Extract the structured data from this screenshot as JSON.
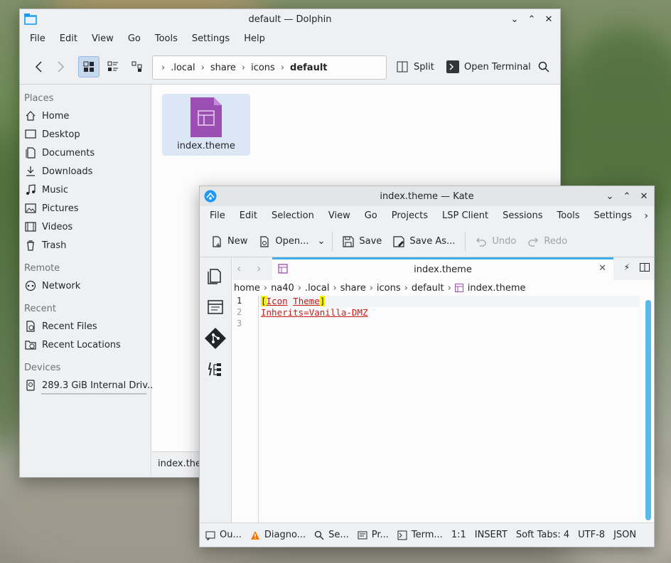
{
  "dolphin": {
    "title": "default — Dolphin",
    "menu": [
      "File",
      "Edit",
      "View",
      "Go",
      "Tools",
      "Settings",
      "Help"
    ],
    "breadcrumb": [
      ".local",
      "share",
      "icons",
      "default"
    ],
    "split_label": "Split",
    "terminal_label": "Open Terminal",
    "sections": {
      "places": "Places",
      "remote": "Remote",
      "recent": "Recent",
      "devices": "Devices"
    },
    "places": [
      "Home",
      "Desktop",
      "Documents",
      "Downloads",
      "Music",
      "Pictures",
      "Videos",
      "Trash"
    ],
    "remote": [
      "Network"
    ],
    "recent": [
      "Recent Files",
      "Recent Locations"
    ],
    "devices": [
      "289.3 GiB Internal Driv..."
    ],
    "file_name": "index.theme",
    "status_text": "index.theme"
  },
  "kate": {
    "title": "index.theme — Kate",
    "menu": [
      "File",
      "Edit",
      "Selection",
      "View",
      "Go",
      "Projects",
      "LSP Client",
      "Sessions",
      "Tools",
      "Settings"
    ],
    "toolbar": {
      "new": "New",
      "open": "Open...",
      "save": "Save",
      "save_as": "Save As...",
      "undo": "Undo",
      "redo": "Redo"
    },
    "tab_title": "index.theme",
    "breadcrumb": [
      "home",
      "na40",
      ".local",
      "share",
      "icons",
      "default",
      "index.theme"
    ],
    "line_numbers": [
      "1",
      "2",
      "3"
    ],
    "code": {
      "line1_open": "[",
      "line1_word1": "Icon",
      "line1_word2": "Theme",
      "line1_close": "]",
      "line2": "Inherits=Vanilla-DMZ"
    },
    "status": {
      "output": "Ou...",
      "diagnostics": "Diagno...",
      "search": "Se...",
      "projects": "Pr...",
      "terminal": "Term...",
      "position": "1:1",
      "mode": "INSERT",
      "indent": "Soft Tabs: 4",
      "encoding": "UTF-8",
      "syntax": "JSON"
    }
  },
  "colors": {
    "accent": "#3daee9",
    "file_icon": "#9b4fb3",
    "selection": "#dbe7f5",
    "code_text": "#c41a16",
    "bracket_highlight": "#f6f200"
  }
}
